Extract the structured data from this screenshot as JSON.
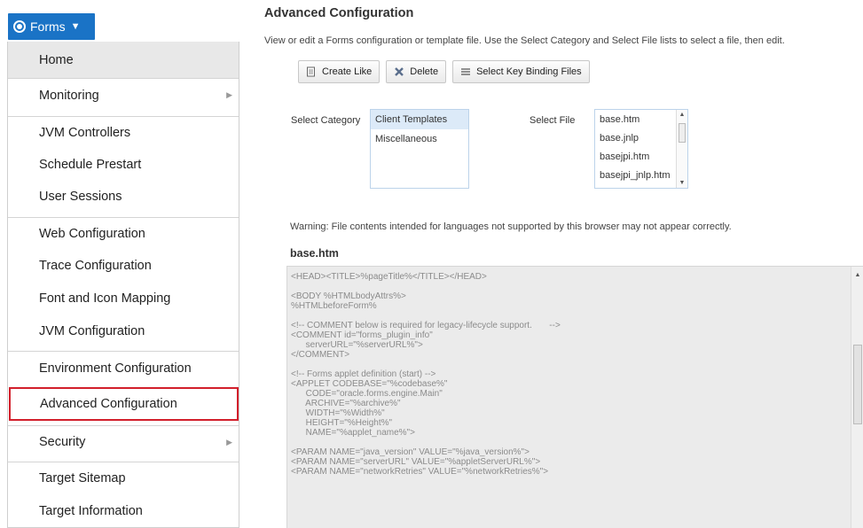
{
  "menu_button": {
    "label": "Forms",
    "caret": "▼"
  },
  "menu": {
    "items": [
      {
        "label": "Home"
      },
      {
        "label": "Monitoring",
        "arrow": "▶"
      },
      {
        "label": "JVM Controllers"
      },
      {
        "label": "Schedule Prestart"
      },
      {
        "label": "User Sessions"
      },
      {
        "label": "Web Configuration"
      },
      {
        "label": "Trace Configuration"
      },
      {
        "label": "Font and Icon Mapping"
      },
      {
        "label": "JVM Configuration"
      },
      {
        "label": "Environment Configuration"
      },
      {
        "label": "Advanced Configuration"
      },
      {
        "label": "Security",
        "arrow": "▶"
      },
      {
        "label": "Target Sitemap"
      },
      {
        "label": "Target Information"
      }
    ]
  },
  "main": {
    "title": "Advanced Configuration",
    "description": "View or edit a Forms configuration or template file. Use the Select Category and Select File lists to select a file, then edit.",
    "toolbar": {
      "create_like": "Create Like",
      "delete": "Delete",
      "select_key_binding": "Select Key Binding Files"
    },
    "category": {
      "label": "Select Category",
      "options": [
        "Client Templates",
        "Miscellaneous"
      ]
    },
    "file": {
      "label": "Select File",
      "options": [
        "base.htm",
        "base.jnlp",
        "basejpi.htm",
        "basejpi_jnlp.htm"
      ]
    },
    "warning": "Warning: File contents intended for languages not supported by this browser may not appear correctly.",
    "file_name": "base.htm",
    "file_content": "<HEAD><TITLE>%pageTitle%</TITLE></HEAD>\n\n<BODY %HTMLbodyAttrs%>\n%HTMLbeforeForm%\n\n<!-- COMMENT below is required for legacy-lifecycle support.       -->\n<COMMENT id=\"forms_plugin_info\"\n      serverURL=\"%serverURL%\">\n</COMMENT>\n\n<!-- Forms applet definition (start) -->\n<APPLET CODEBASE=\"%codebase%\"\n      CODE=\"oracle.forms.engine.Main\"\n      ARCHIVE=\"%archive%\"\n      WIDTH=\"%Width%\"\n      HEIGHT=\"%Height%\"\n      NAME=\"%applet_name%\">\n\n<PARAM NAME=\"java_version\" VALUE=\"%java_version%\">\n<PARAM NAME=\"serverURL\" VALUE=\"%appletServerURL%\">\n<PARAM NAME=\"networkRetries\" VALUE=\"%networkRetries%\">"
  },
  "colors": {
    "accent": "#1a73c6",
    "selected_outline": "#d21f2b",
    "list_selected": "#dceaf8"
  }
}
